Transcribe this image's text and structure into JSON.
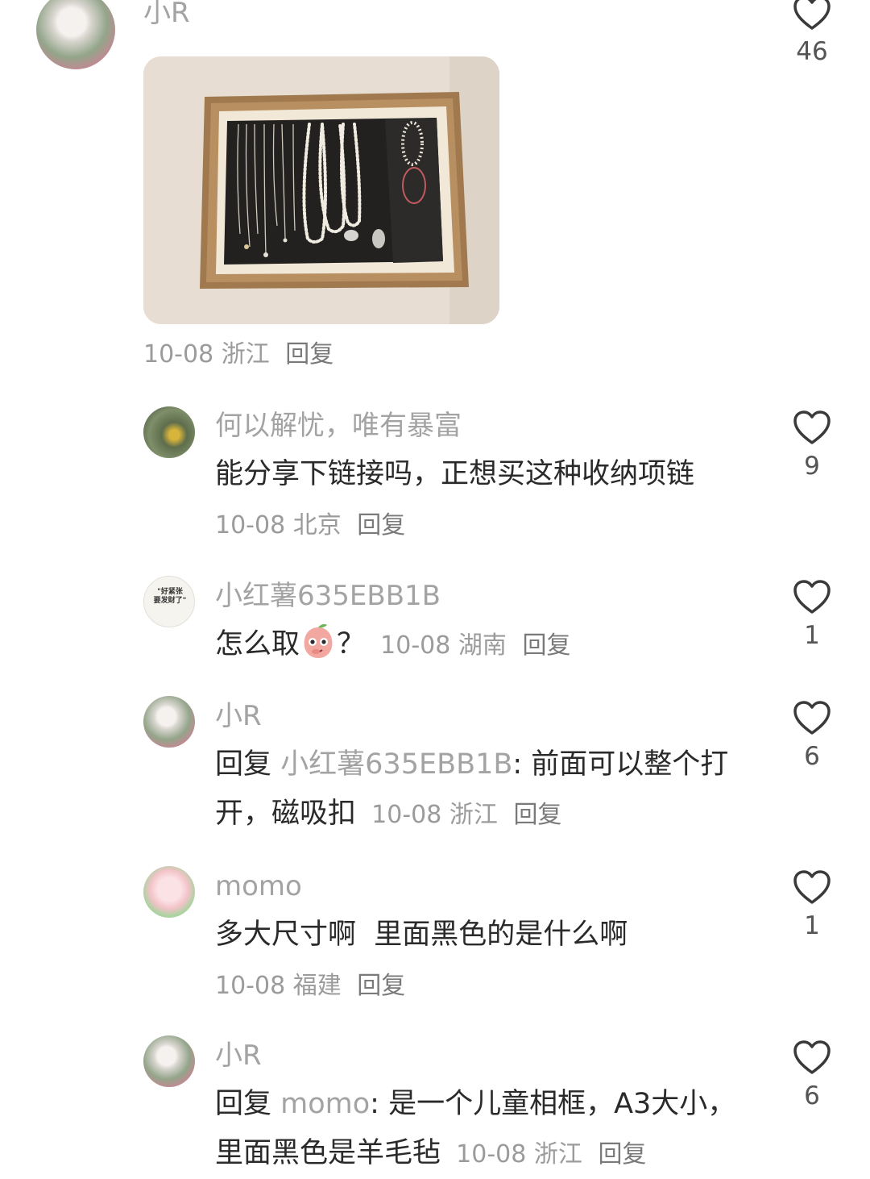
{
  "comments": [
    {
      "user": "小R",
      "date": "10-08",
      "location": "浙江",
      "reply_label": "回复",
      "likes": "46"
    },
    {
      "user": "何以解忧，唯有暴富",
      "text": "能分享下链接吗，正想买这种收纳项链",
      "date": "10-08",
      "location": "北京",
      "reply_label": "回复",
      "likes": "9"
    },
    {
      "user": "小红薯635EBB1B",
      "text_before_emoji": "怎么取",
      "text_after_emoji": "？",
      "date": "10-08",
      "location": "湖南",
      "reply_label": "回复",
      "likes": "1"
    },
    {
      "user": "小R",
      "reply_prefix": "回复",
      "mention": "小红薯635EBB1B",
      "text": ": 前面可以整个打开，磁吸扣",
      "date": "10-08",
      "location": "浙江",
      "reply_label": "回复",
      "likes": "6"
    },
    {
      "user": "momo",
      "text": "多大尺寸啊  里面黑色的是什么啊",
      "date": "10-08",
      "location": "福建",
      "reply_label": "回复",
      "likes": "1"
    },
    {
      "user": "小R",
      "reply_prefix": "回复",
      "mention": "momo",
      "text": ": 是一个儿童相框，A3大小，里面黑色是羊毛毡",
      "date": "10-08",
      "location": "浙江",
      "reply_label": "回复",
      "likes": "6"
    }
  ],
  "avatar_labels": {
    "sticker_line1": "\"好紧张",
    "sticker_line2": "要发财了\""
  },
  "colors": {
    "username": "#a3a3a3",
    "body_text": "#2a2a2a",
    "meta": "#9b9b9b",
    "heart_outline": "#3a3a3a"
  }
}
